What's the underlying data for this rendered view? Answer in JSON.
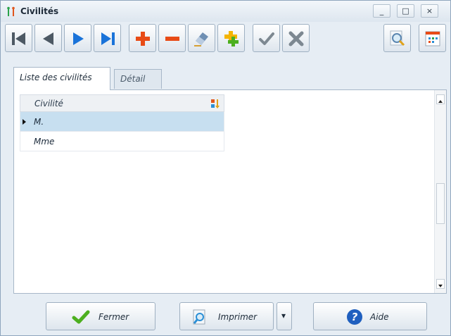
{
  "window": {
    "title": "Civilités",
    "controls": {
      "minimize": "_",
      "maximize": "□",
      "close": "×"
    }
  },
  "toolbar": {
    "buttons": [
      {
        "name": "first-record",
        "icon": "first-icon"
      },
      {
        "name": "previous-record",
        "icon": "previous-icon"
      },
      {
        "name": "next-record",
        "icon": "next-icon"
      },
      {
        "name": "last-record",
        "icon": "last-icon"
      },
      {
        "name": "add-record",
        "icon": "plus-icon"
      },
      {
        "name": "delete-record",
        "icon": "minus-icon"
      },
      {
        "name": "edit-record",
        "icon": "eraser-icon"
      },
      {
        "name": "duplicate-record",
        "icon": "duplicate-icon"
      },
      {
        "name": "validate",
        "icon": "check-icon"
      },
      {
        "name": "cancel",
        "icon": "cross-icon"
      },
      {
        "name": "search",
        "icon": "magnifier-icon"
      },
      {
        "name": "filter",
        "icon": "calendar-icon"
      }
    ]
  },
  "tabs": [
    {
      "label": "Liste des civilités",
      "active": true
    },
    {
      "label": "Détail",
      "active": false
    }
  ],
  "grid": {
    "header": "Civilité",
    "rows": [
      {
        "value": "M.",
        "selected": true
      },
      {
        "value": "Mme",
        "selected": false
      }
    ]
  },
  "footer": {
    "close_label": "Fermer",
    "print_label": "Imprimer",
    "print_dropdown": "▾",
    "help_label": "Aide"
  },
  "colors": {
    "accent": "#1a73d9",
    "selected_row": "#c7dff0",
    "add": "#e84b16",
    "check": "#4caf1f"
  }
}
